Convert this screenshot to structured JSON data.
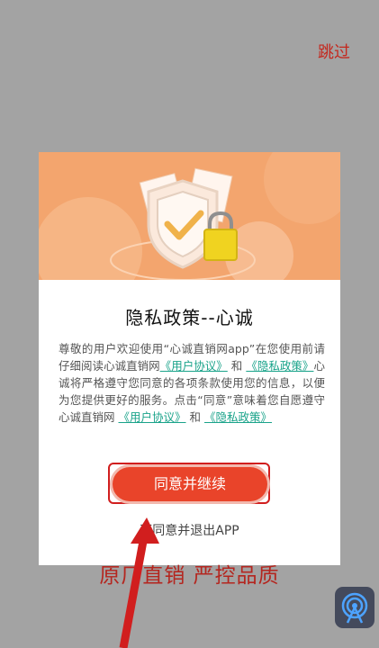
{
  "skip_label": "跳过",
  "dialog": {
    "title": "隐私政策--心诚",
    "text_p1": "尊敬的用户欢迎使用“心诚直销网app”在您使用前请仔细阅读心诚直销网",
    "link_user_agreement": "《用户协议》",
    "text_and": "和",
    "link_privacy_policy": "《隐私政策》",
    "text_p2": "心诚将严格遵守您同意的各项条款使用您的信息，以便为您提供更好的服务。点击“同意”意味着您自愿遵守心诚直销网",
    "text_and_2": "和",
    "agree_button": "同意并继续",
    "decline_link": "不同意并退出APP"
  },
  "slogan": "原厂直销  严控品质",
  "colors": {
    "accent": "#e9442a",
    "banner": "#f3a56e",
    "link": "#1aa38a",
    "slogan": "#b4261f"
  }
}
